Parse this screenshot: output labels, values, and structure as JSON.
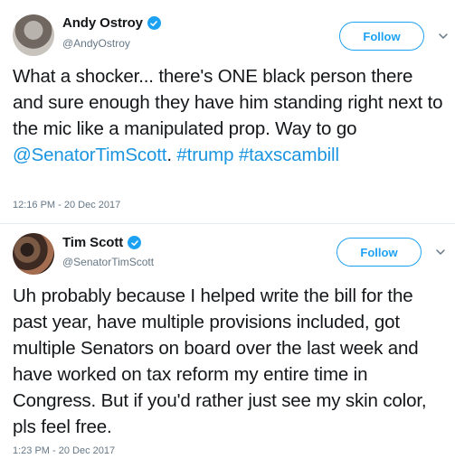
{
  "tweets": [
    {
      "display_name": "Andy Ostroy",
      "handle": "@AndyOstroy",
      "follow_label": "Follow",
      "avatar_icon": "avatar-photo",
      "verified_icon": "verified-badge-icon",
      "text_parts": {
        "t1": "What a shocker... there's ONE black person there and sure enough they have him standing right next to the mic like a manipulated prop. Way to go ",
        "mention": "@SenatorTimScott",
        "t2": ". ",
        "hashtag1": "#trump",
        "t3": " ",
        "hashtag2": "#taxscambill"
      },
      "timestamp": "12:16 PM - 20 Dec 2017"
    },
    {
      "display_name": "Tim Scott",
      "handle": "@SenatorTimScott",
      "follow_label": "Follow",
      "avatar_icon": "avatar-photo",
      "verified_icon": "verified-badge-icon",
      "text": "Uh probably because I helped write the bill for the past year, have multiple provisions included, got multiple Senators on board over the last week and have worked on tax reform my entire time in Congress. But if you'd rather just see my skin color, pls feel free.",
      "timestamp": "1:23 PM - 20 Dec 2017"
    }
  ],
  "colors": {
    "accent": "#1da1f2",
    "link": "#1b95e0",
    "text": "#14171a",
    "muted": "#657786"
  }
}
